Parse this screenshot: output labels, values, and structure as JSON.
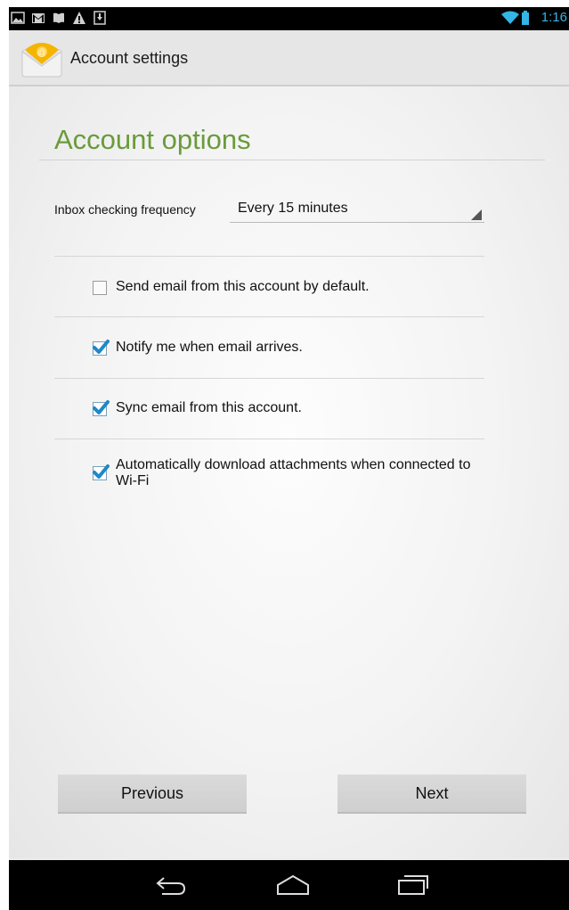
{
  "status_bar": {
    "time": "1:16",
    "left_icons": [
      "picture-icon",
      "gmail-icon",
      "books-icon",
      "warning-icon",
      "download-icon"
    ],
    "right_icons": [
      "wifi-icon",
      "battery-icon"
    ],
    "accent_color": "#33b5e5"
  },
  "action_bar": {
    "title": "Account settings",
    "icon": "email-app-icon"
  },
  "main": {
    "heading": "Account options",
    "heading_color": "#6a9b3a",
    "frequency": {
      "label": "Inbox checking frequency",
      "value": "Every 15 minutes"
    },
    "options": [
      {
        "label": "Send email from this account by default.",
        "checked": false
      },
      {
        "label": "Notify me when email arrives.",
        "checked": true
      },
      {
        "label": "Sync email from this account.",
        "checked": true
      },
      {
        "label": "Automatically download attachments when connected to Wi-Fi",
        "checked": true
      }
    ],
    "check_color": "#1e88c8"
  },
  "buttons": {
    "previous": "Previous",
    "next": "Next"
  },
  "nav_bar": {
    "icons": [
      "back-icon",
      "home-icon",
      "recent-apps-icon"
    ]
  }
}
